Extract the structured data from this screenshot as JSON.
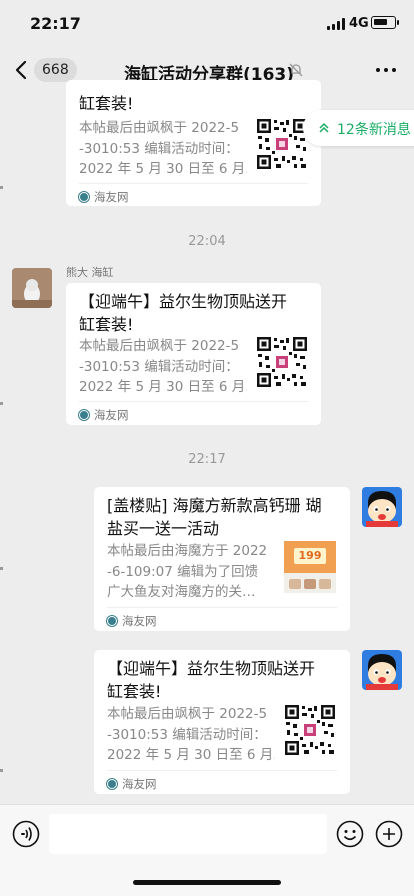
{
  "status_bar": {
    "time": "22:17",
    "network": "4G",
    "battery_level": 0.7
  },
  "nav": {
    "unread_count": "668",
    "title": "海缸活动分享群(163)"
  },
  "new_messages_badge": "12条新消息",
  "messages": [
    {
      "sender": "",
      "title": "缸套装!",
      "desc": "本帖最后由飒枫于 2022-5\n-3010:53 编辑活动时间：\n2022 年 5 月 30 日至 6 月…",
      "source": "海友网"
    },
    {
      "divider": "22:04"
    },
    {
      "sender": "熊大 海缸",
      "title": "【迎端午】益尔生物顶贴送开\n缸套装!",
      "desc": "本帖最后由飒枫于 2022-5\n-3010:53 编辑活动时间：\n2022 年 5 月 30 日至 6 月…",
      "source": "海友网"
    },
    {
      "divider": "22:17"
    },
    {
      "title": "[盖楼贴] 海魔方新款高钙珊 瑚\n盐买一送一活动",
      "desc": "本帖最后由海魔方于 2022\n-6-109:07 编辑为了回馈\n广大鱼友对海魔方的关…",
      "thumb_text": "199",
      "source": "海友网"
    },
    {
      "title": "【迎端午】益尔生物顶贴送开\n缸套装!",
      "desc": "本帖最后由飒枫于 2022-5\n-3010:53 编辑活动时间：\n2022 年 5 月 30 日至 6 月…",
      "source": "海友网"
    }
  ],
  "icons": [
    "back-chevron-icon",
    "mute-icon",
    "more-icon",
    "double-up-arrow-icon",
    "voice-icon",
    "emoji-icon",
    "plus-icon",
    "qr-code-icon",
    "source-logo-icon"
  ],
  "colors": {
    "background": "#ededed",
    "accent_green": "#1aad66",
    "card": "#ffffff"
  }
}
